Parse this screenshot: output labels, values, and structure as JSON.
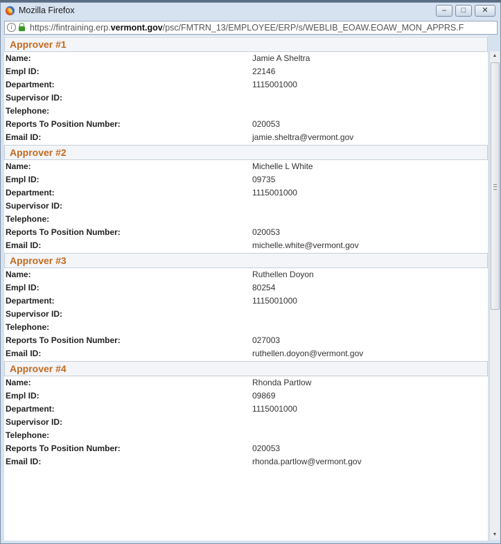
{
  "window": {
    "title": "Mozilla Firefox",
    "url_prefix": "https://fintraining.erp.",
    "url_domain": "vermont.gov",
    "url_path": "/psc/FMTRN_13/EMPLOYEE/ERP/s/WEBLIB_EOAW.EOAW_MON_APPRS.F"
  },
  "labels": {
    "name": "Name:",
    "empl_id": "Empl ID:",
    "department": "Department:",
    "supervisor_id": "Supervisor ID:",
    "telephone": "Telephone:",
    "reports_to": "Reports To Position Number:",
    "email_id": "Email ID:"
  },
  "approvers": [
    {
      "header": "Approver #1",
      "name": "Jamie A Sheltra",
      "empl_id": "22146",
      "department": "1115001000",
      "supervisor_id": "",
      "telephone": "",
      "reports_to": "020053",
      "email": "jamie.sheltra@vermont.gov"
    },
    {
      "header": "Approver #2",
      "name": "Michelle L White",
      "empl_id": "09735",
      "department": "1115001000",
      "supervisor_id": "",
      "telephone": "",
      "reports_to": "020053",
      "email": "michelle.white@vermont.gov"
    },
    {
      "header": "Approver #3",
      "name": "Ruthellen Doyon",
      "empl_id": "80254",
      "department": "1115001000",
      "supervisor_id": "",
      "telephone": "",
      "reports_to": "027003",
      "email": "ruthellen.doyon@vermont.gov"
    },
    {
      "header": "Approver #4",
      "name": "Rhonda Partlow",
      "empl_id": "09869",
      "department": "1115001000",
      "supervisor_id": "",
      "telephone": "",
      "reports_to": "020053",
      "email": "rhonda.partlow@vermont.gov"
    }
  ],
  "colors": {
    "section_header_text": "#c46a1e",
    "titlebar_bg": "#d6e2f0"
  }
}
